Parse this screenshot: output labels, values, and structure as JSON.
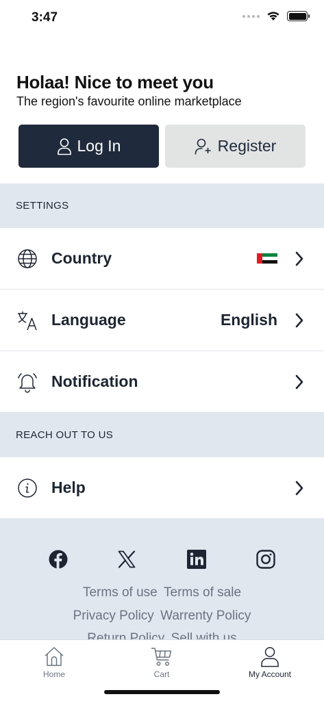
{
  "status_bar": {
    "time": "3:47"
  },
  "greeting": {
    "title": "Holaa! Nice to meet you",
    "subtitle": "The region's favourite online marketplace"
  },
  "auth": {
    "login_label": "Log In",
    "register_label": "Register"
  },
  "settings": {
    "header": "SETTINGS",
    "rows": [
      {
        "label": "Country",
        "value_icon": "uae-flag-icon"
      },
      {
        "label": "Language",
        "value": "English"
      },
      {
        "label": "Notification"
      }
    ]
  },
  "reach_out": {
    "header": "REACH OUT TO US",
    "rows": [
      {
        "label": "Help"
      }
    ]
  },
  "social": [
    "facebook-icon",
    "x-icon",
    "linkedin-icon",
    "instagram-icon"
  ],
  "footer_links": {
    "row1": [
      "Terms of use",
      "Terms of sale"
    ],
    "row2": [
      "Privacy Policy",
      "Warrenty Policy"
    ],
    "row3": [
      "Return Policy",
      "Sell with us"
    ]
  },
  "tabs": [
    {
      "label": "Home",
      "icon": "home-icon"
    },
    {
      "label": "Cart",
      "icon": "cart-icon"
    },
    {
      "label": "My Account",
      "icon": "account-icon",
      "active": true
    }
  ],
  "colors": {
    "primary": "#1f2a3c",
    "section_bg": "#e0e7ef",
    "secondary_button": "#e2e3e3"
  }
}
